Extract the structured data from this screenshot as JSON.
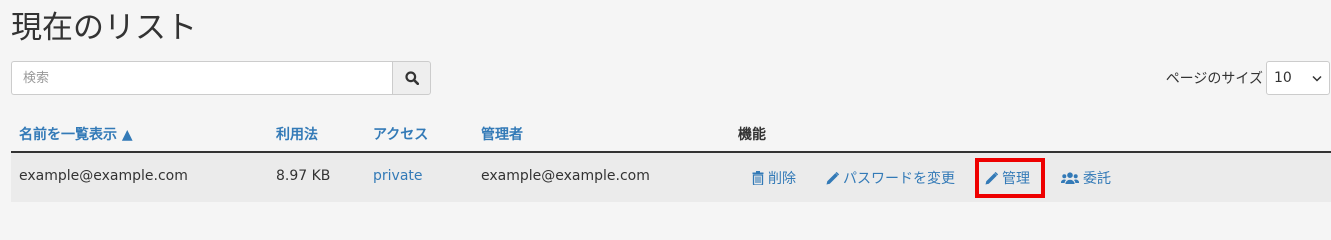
{
  "header": {
    "title": "現在のリスト"
  },
  "search": {
    "placeholder": "検索"
  },
  "page_size": {
    "label": "ページのサイズ",
    "selected": "10"
  },
  "table": {
    "columns": {
      "name": "名前を一覧表示 ▲",
      "usage": "利用法",
      "access": "アクセス",
      "admin": "管理者",
      "functions": "機能"
    },
    "rows": [
      {
        "name": "example@example.com",
        "usage": "8.97 KB",
        "access": "private",
        "admin": "example@example.com",
        "actions": {
          "delete": "削除",
          "change_password": "パスワードを変更",
          "manage": "管理",
          "delegate": "委託"
        }
      }
    ]
  },
  "colors": {
    "link": "#337ab7",
    "highlight": "#ee0000",
    "row_bg": "#ebebeb",
    "page_bg": "#f5f5f5"
  }
}
